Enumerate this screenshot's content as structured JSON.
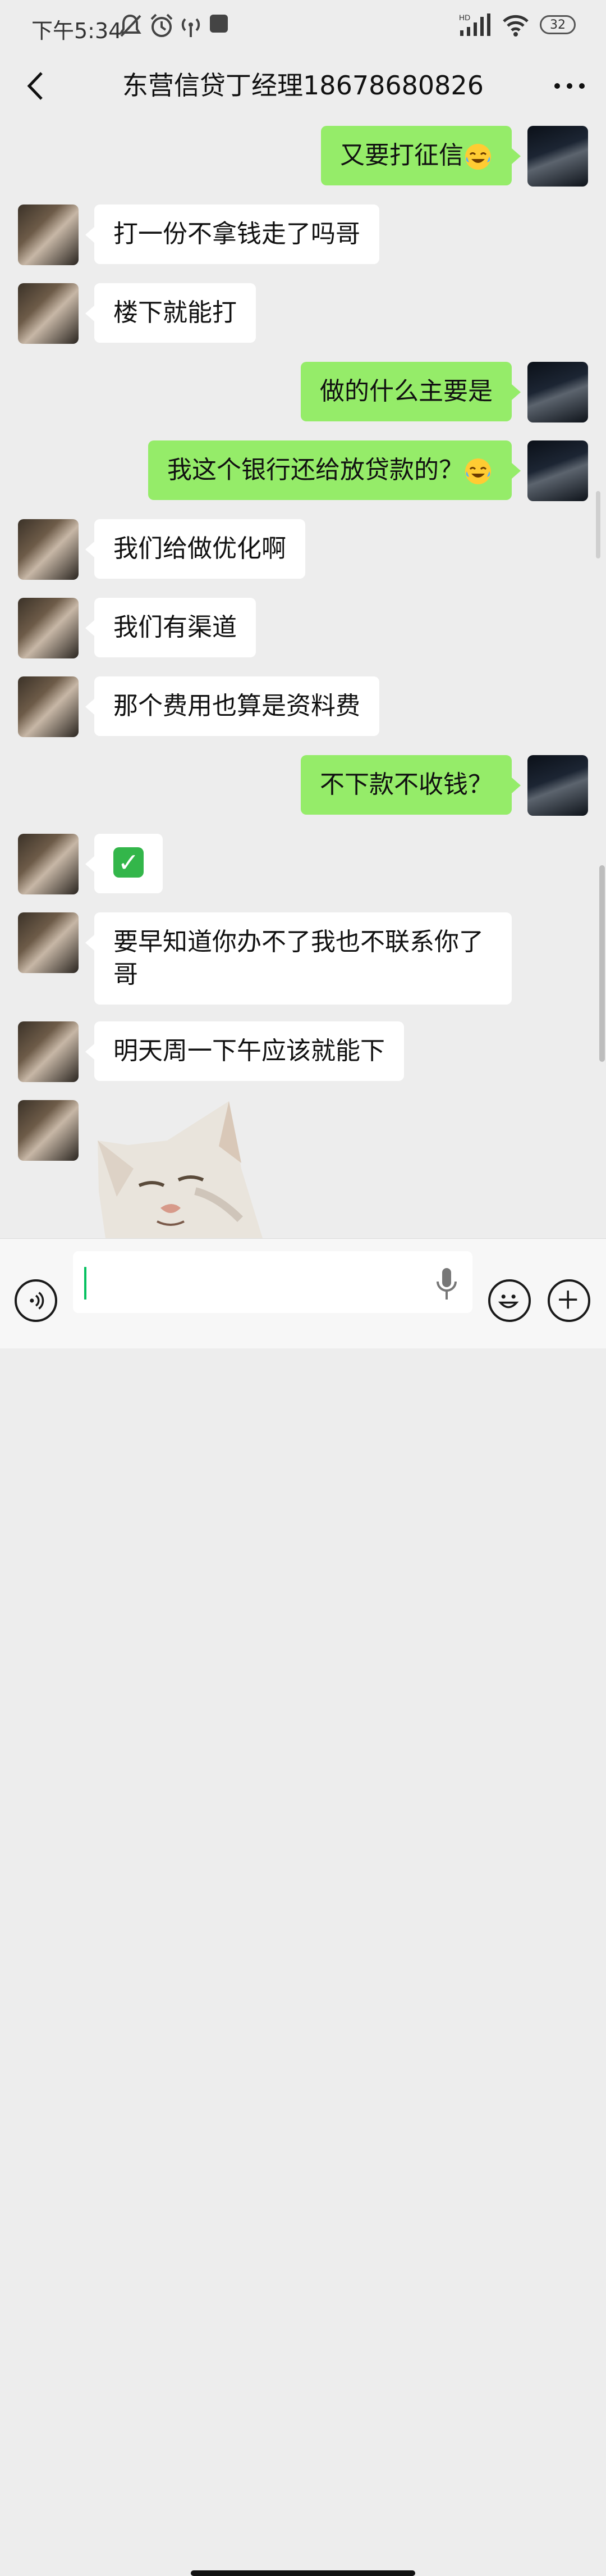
{
  "status_bar": {
    "time": "下午5:34",
    "battery": "32",
    "signal_label": "HD"
  },
  "header": {
    "title": "东营信贷丁经理18678680826"
  },
  "messages": [
    {
      "side": "out",
      "text": "又要打征信",
      "emoji": "laughing-crying-emoji"
    },
    {
      "side": "in",
      "text": "打一份不拿钱走了吗哥"
    },
    {
      "side": "in",
      "text": "楼下就能打"
    },
    {
      "side": "out",
      "text": "做的什么主要是"
    },
    {
      "side": "out",
      "text": "我这个银行还给放贷款的？",
      "emoji": "laughing-crying-emoji"
    },
    {
      "side": "in",
      "text": "我们给做优化啊"
    },
    {
      "side": "in",
      "text": "我们有渠道"
    },
    {
      "side": "in",
      "text": "那个费用也算是资料费"
    },
    {
      "side": "out",
      "text": "不下款不收钱？"
    },
    {
      "side": "in",
      "text": "✓",
      "emoji": "check-mark-emoji"
    },
    {
      "side": "in",
      "text": "要早知道你办不了我也不联系你了哥"
    },
    {
      "side": "in",
      "text": "明天周一下午应该就能下"
    },
    {
      "side": "in",
      "sticker": "cat-sticker"
    }
  ],
  "input": {
    "placeholder": ""
  }
}
